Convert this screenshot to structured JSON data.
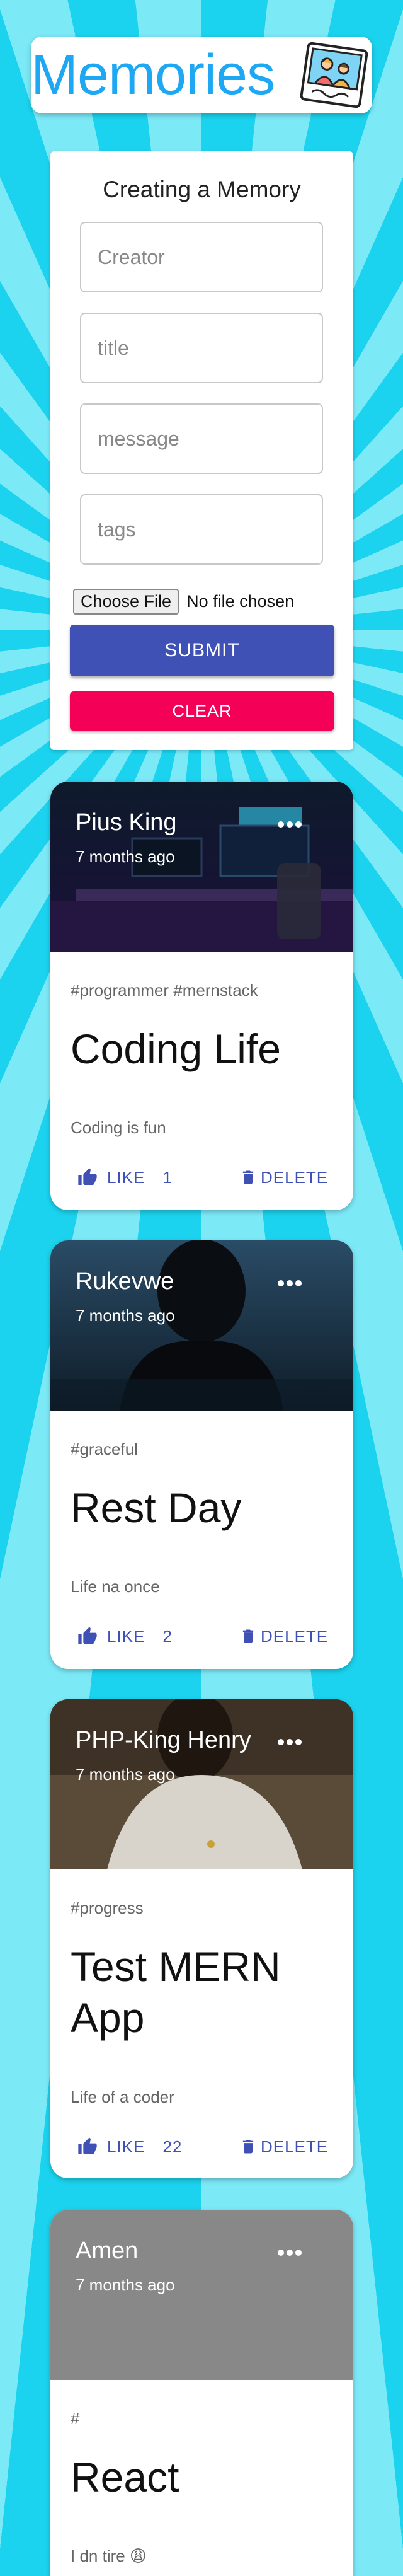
{
  "header": {
    "brand": "Memories",
    "logo_icon": "memories-photo-logo"
  },
  "form": {
    "title": "Creating a Memory",
    "creator_placeholder": "Creator",
    "title_placeholder": "title",
    "message_placeholder": "message",
    "tags_placeholder": "tags",
    "file_button": "Choose File",
    "file_status": "No file chosen",
    "submit_label": "SUBMIT",
    "clear_label": "CLEAR"
  },
  "posts": [
    {
      "creator": "Pius King",
      "time": "7 months ago",
      "tags": "#programmer #mernstack",
      "title": "Coding Life",
      "message": "Coding is fun",
      "like_label": "LIKE",
      "likes": "1",
      "delete_label": "DELETE"
    },
    {
      "creator": "Rukevwe",
      "time": "7 months ago",
      "tags": "#graceful",
      "title": "Rest Day",
      "message": "Life na once",
      "like_label": "LIKE",
      "likes": "2",
      "delete_label": "DELETE"
    },
    {
      "creator": "PHP-King Henry",
      "time": "7 months ago",
      "tags": "#progress",
      "title": "Test MERN App",
      "message": "Life of a coder",
      "like_label": "LIKE",
      "likes": "22",
      "delete_label": "DELETE"
    },
    {
      "creator": "Amen",
      "time": "7 months ago",
      "tags": "#",
      "title": "React",
      "message": "I dn tire 😩"
    }
  ],
  "colors": {
    "primary": "#3f51b5",
    "secondary": "#f50057",
    "brand": "#1ea7f2",
    "background": "#27d7f0"
  }
}
